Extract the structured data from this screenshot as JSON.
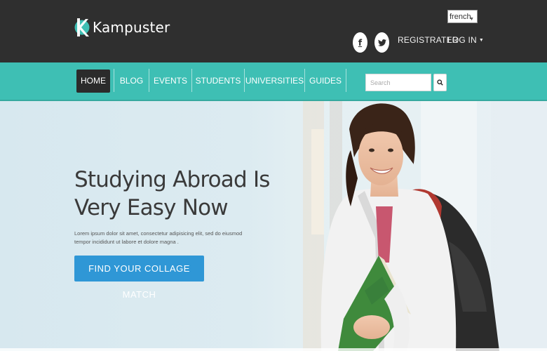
{
  "brand": {
    "name": "Kampuster",
    "logo_icon": "k-logo-icon",
    "accent_color": "#3ebfb4"
  },
  "topbar": {
    "language": "french",
    "social": [
      {
        "icon": "facebook-icon",
        "glyph": "f"
      },
      {
        "icon": "twitter-icon"
      }
    ],
    "register_label": "REGISTRATER",
    "login_label": "LOG IN"
  },
  "nav": {
    "items": [
      {
        "label": "HOME",
        "active": true
      },
      {
        "label": "BLOG"
      },
      {
        "label": "EVENTS"
      },
      {
        "label": "STUDENTS"
      },
      {
        "label": "UNIVERSITIES"
      },
      {
        "label": "GUIDES"
      }
    ],
    "search_placeholder": "Search",
    "search_icon": "search-icon"
  },
  "hero": {
    "title": "Studying Abroad Is Very Easy Now",
    "description": "Lorem ipsum dolor sit amet, consectetur adipisicing elit, sed do eiusmod tempor incididunt ut labore et dolore magna .",
    "cta_label": "FIND YOUR COLLAGE MATCH",
    "cta_color": "#2f97d6"
  }
}
